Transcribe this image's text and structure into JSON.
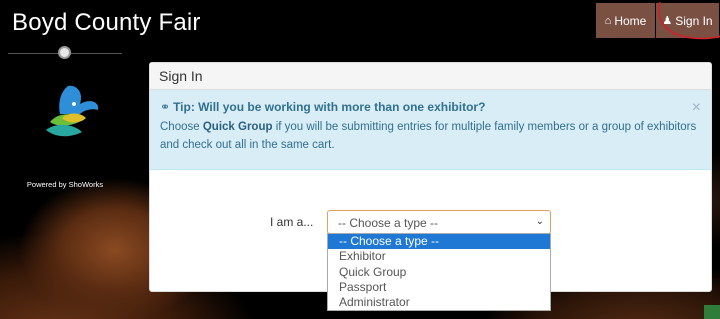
{
  "site": {
    "title": "Boyd County Fair"
  },
  "nav": {
    "home_label": "Home",
    "signin_label": "Sign In"
  },
  "sidebar": {
    "powered_by": "Powered by ShoWorks"
  },
  "panel": {
    "heading": "Sign In",
    "tip": {
      "title": "Tip: Will you be working with more than one exhibitor?",
      "body_prefix": "Choose ",
      "body_bold": "Quick Group",
      "body_suffix": " if you will be submitting entries for multiple family members or a group of exhibitors and check out all in the same cart.",
      "close": "×"
    },
    "form": {
      "label": "I am a...",
      "select_value": "-- Choose a type --",
      "options": [
        "-- Choose a type --",
        "Exhibitor",
        "Quick Group",
        "Passport",
        "Administrator"
      ],
      "selected_index": 0
    }
  },
  "colors": {
    "nav_bg": "#7a5042",
    "alert_bg": "#d9edf7",
    "select_highlight": "#1e78d4"
  }
}
